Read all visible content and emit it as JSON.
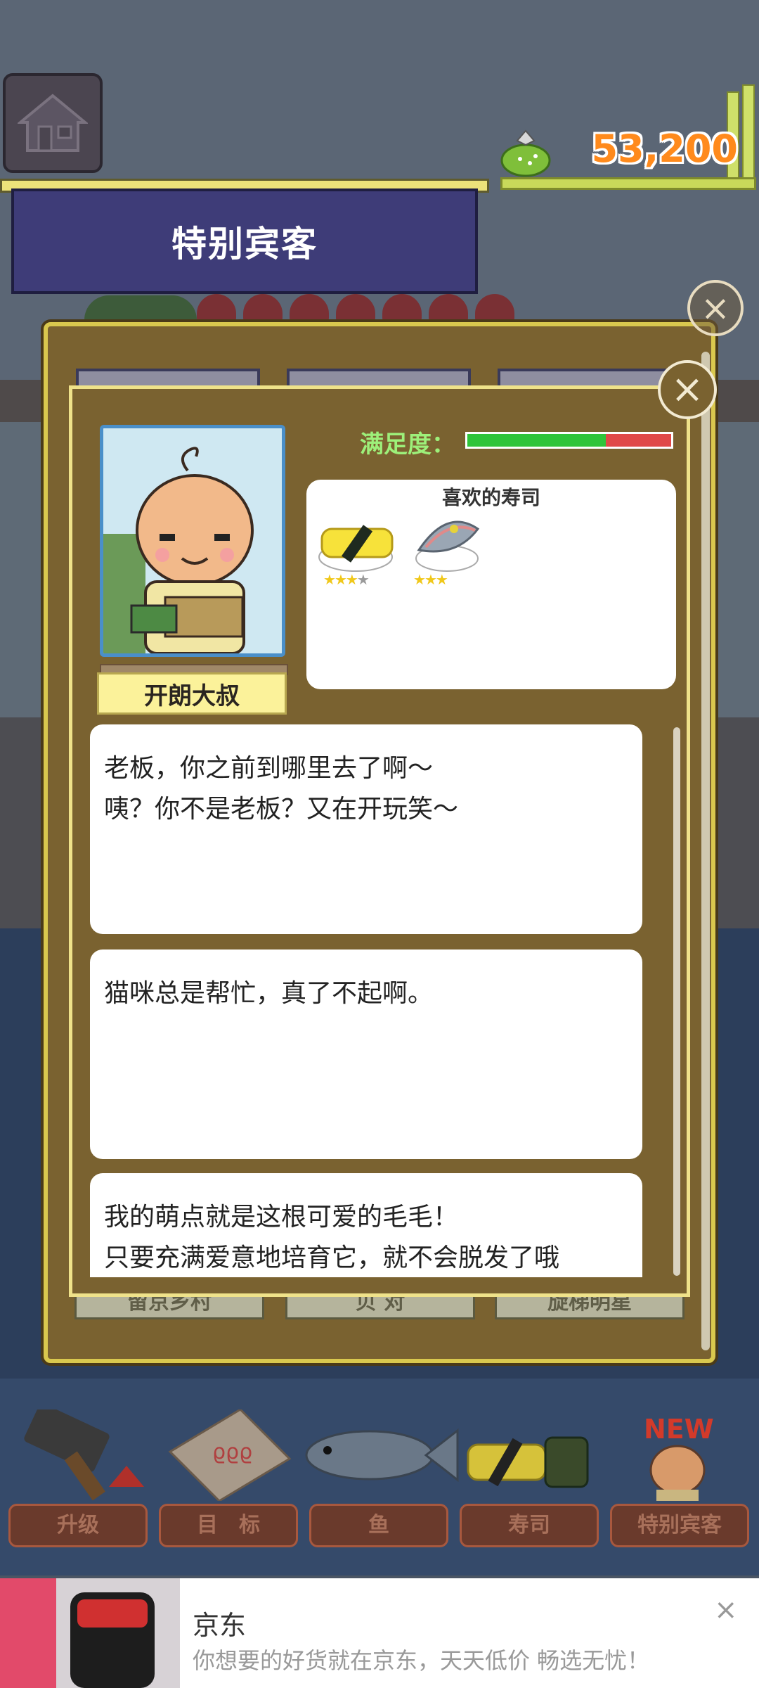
{
  "header": {
    "money": "53,200",
    "banner_title": "特别宾客"
  },
  "guest": {
    "name": "开朗大叔",
    "satisfaction_label": "满足度：",
    "satisfaction_level": 0.68,
    "favorite_sushi_title": "喜欢的寿司",
    "favorites": [
      {
        "icon": "tamago-sushi-icon",
        "stars_filled": 3,
        "stars_total": 4
      },
      {
        "icon": "saba-sushi-icon",
        "stars_filled": 3,
        "stars_total": 3
      }
    ]
  },
  "dialogs": [
    {
      "lines": [
        "老板，你之前到哪里去了啊～",
        "咦？你不是老板？又在开玩笑～"
      ]
    },
    {
      "lines": [
        "猫咪总是帮忙，真了不起啊。"
      ]
    },
    {
      "lines": [
        "我的萌点就是这根可爱的毛毛！",
        "只要充满爱意地培育它，就不会脱发了哦"
      ]
    }
  ],
  "background_panel": {
    "bottom_buttons": [
      "留京乡村",
      "贝 对",
      "旋梯明星"
    ]
  },
  "nav": {
    "items": [
      {
        "label": "升级",
        "icon": "hammer-icon"
      },
      {
        "label": "目　标",
        "icon": "target-board-icon"
      },
      {
        "label": "鱼",
        "icon": "fish-icon"
      },
      {
        "label": "寿司",
        "icon": "sushi-icon"
      },
      {
        "label": "特别宾客",
        "icon": "guest-icon"
      }
    ],
    "new_badge": "NEW"
  },
  "ad": {
    "title": "京东",
    "description": "你想要的好货就在京东，天天低价 畅选无忧！"
  },
  "colors": {
    "panel": "#7a6230",
    "panel_border": "#efe28a",
    "banner": "#3e3c78",
    "money": "#ff8a1c",
    "satisfaction_good": "#2fc43a",
    "satisfaction_bad": "#e04848"
  }
}
